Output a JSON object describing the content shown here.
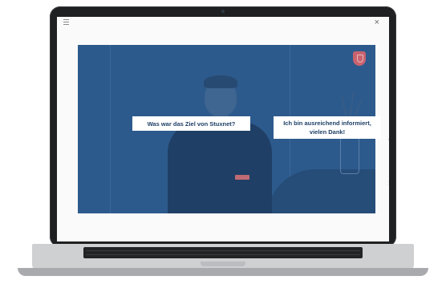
{
  "toolbar": {
    "menu_icon": "hamburger-menu-icon",
    "close_label": "×"
  },
  "video": {
    "description_icon": "shield-logo-icon"
  },
  "choices": [
    {
      "label": "Was war das Ziel von Stuxnet?"
    },
    {
      "label": "Ich bin ausreichend informiert, vielen Dank!"
    }
  ],
  "nav": {
    "prev_label": "‹",
    "next_label": "›"
  },
  "colors": {
    "overlay": "#2d5a8c",
    "choice_text": "#1e3f66",
    "logo": "#c9636e"
  }
}
